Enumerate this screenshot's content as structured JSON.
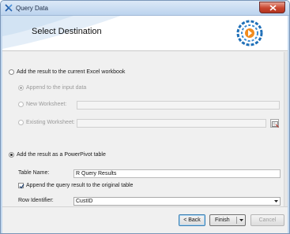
{
  "window": {
    "title": "Query Data"
  },
  "header": {
    "title": "Select Destination"
  },
  "options": {
    "excel_radio_label": "Add the result to the current Excel workbook",
    "append_label": "Append to the input data",
    "new_ws_label": "New Worksheet:",
    "new_ws_value": "",
    "existing_ws_label": "Existing Worksheet:",
    "existing_ws_value": "",
    "powerpivot_radio_label": "Add the result as a PowerPivot table",
    "table_name_label": "Table Name:",
    "table_name_value": "R Query Results",
    "append_query_label": "Append the query result to the original table",
    "row_identifier_label": "Row Identifier:",
    "row_identifier_value": "CustID"
  },
  "footer": {
    "back_label": "< Back",
    "finish_label": "Finish",
    "cancel_label": "Cancel"
  },
  "colors": {
    "accent": "#1e6fb8",
    "title_bar": "#c4d9ef",
    "close": "#c9462f",
    "logo_orange": "#f28c1e"
  }
}
